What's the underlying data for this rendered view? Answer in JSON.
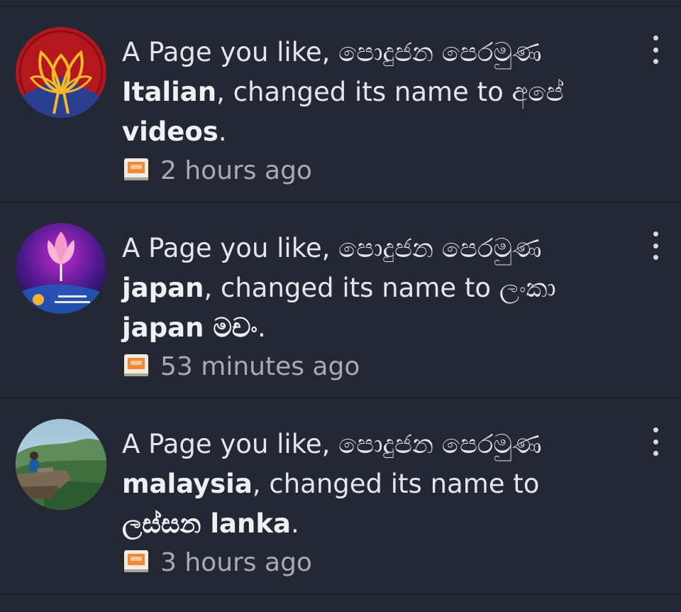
{
  "notifications": [
    {
      "prefix": "A Page you like, පොදුජන පෙරමුණ ",
      "old_name_bold": "Italian",
      "middle": ", changed its name to අපේ ",
      "new_name_bold": "videos",
      "suffix": ".",
      "time": "2 hours ago",
      "avatar": "lotus-logo-red"
    },
    {
      "prefix": "A Page you like, පොදුජන පෙරමුණ ",
      "old_name_bold": "japan",
      "middle": ", changed its name to ලංකා ",
      "new_name_bold": "japan මචං",
      "suffix": ".",
      "time": "53 minutes ago",
      "avatar": "lotus-logo-purple"
    },
    {
      "prefix": "A Page you like, පොදුජන පෙරමුණ ",
      "old_name_bold": "malaysia",
      "middle": ", changed its name to ",
      "new_name_bold": "ලස්සන lanka",
      "suffix": ".",
      "time": "3 hours ago",
      "avatar": "landscape-photo"
    }
  ],
  "colors": {
    "background": "#232834",
    "text": "#e4e6eb",
    "muted": "#a8abb2",
    "divider": "#1a1e27"
  }
}
